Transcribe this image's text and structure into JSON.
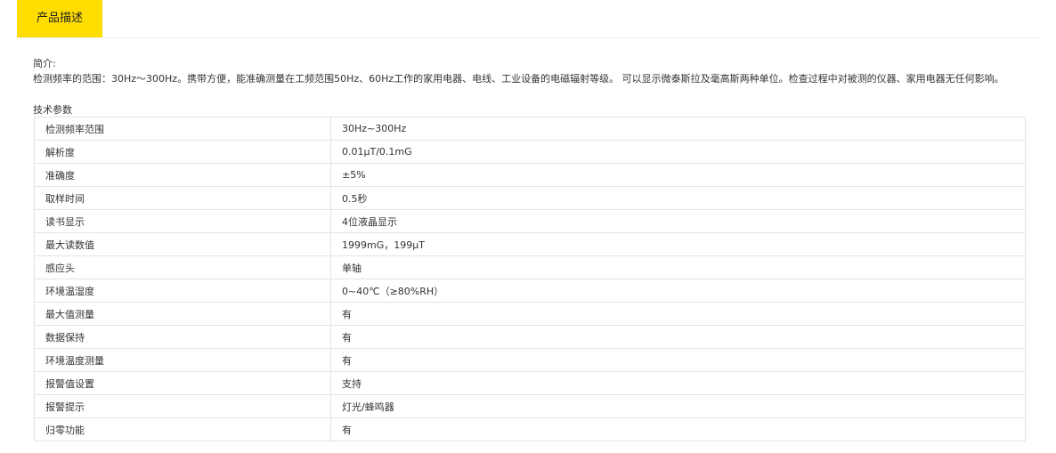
{
  "tabs": {
    "active_label": "产品描述"
  },
  "description": {
    "label": "简介:",
    "text": "检测频率的范围：30Hz～300Hz。携带方便，能准确测量在工频范围50Hz、60Hz工作的家用电器、电线、工业设备的电磁辐射等级。 可以显示微泰斯拉及毫高斯两种单位。检查过程中对被测的仪器、家用电器无任何影响。"
  },
  "specs": {
    "title": "技术参数",
    "rows": [
      {
        "name": "检测频率范围",
        "value": "30Hz~300Hz"
      },
      {
        "name": "解析度",
        "value": "0.01μT/0.1mG"
      },
      {
        "name": "准确度",
        "value": "±5%"
      },
      {
        "name": "取样时间",
        "value": "0.5秒"
      },
      {
        "name": "读书显示",
        "value": "4位液晶显示"
      },
      {
        "name": "最大读数值",
        "value": "1999mG，199μT"
      },
      {
        "name": "感应头",
        "value": "单轴"
      },
      {
        "name": "环境温湿度",
        "value": "0~40℃（≥80%RH）"
      },
      {
        "name": "最大值测量",
        "value": "有"
      },
      {
        "name": "数据保持",
        "value": "有"
      },
      {
        "name": "环境温度测量",
        "value": "有"
      },
      {
        "name": "报警值设置",
        "value": "支持"
      },
      {
        "name": "报警提示",
        "value": "灯光/蜂鸣器"
      },
      {
        "name": "归零功能",
        "value": "有"
      }
    ]
  },
  "colors": {
    "tab_accent": "#ffdd00",
    "table_border": "#e4e4e4"
  }
}
